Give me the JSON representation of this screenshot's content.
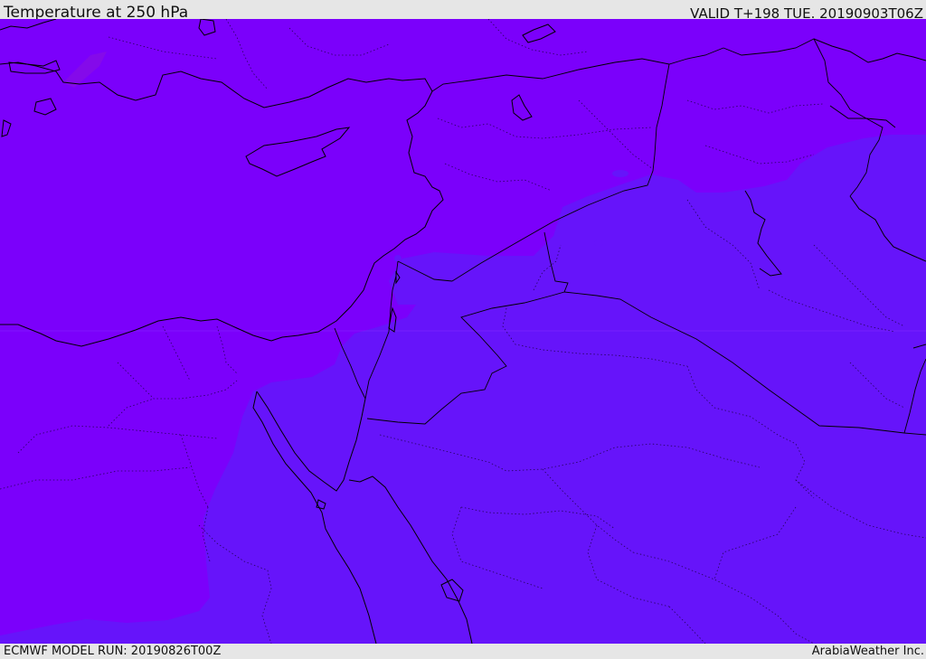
{
  "header": {
    "title": "Temperature at 250 hPa",
    "valid_time": "VALID T+198 TUE. 20190903T06Z"
  },
  "footer": {
    "model_run": "ECMWF MODEL RUN: 20190826T00Z",
    "credit": "ArabiaWeather Inc."
  },
  "map": {
    "field": "temperature-250hPa",
    "colors": {
      "warmer_field": "#7b00fb",
      "cooler_field": "#6614fa",
      "hotspot": "#8a10e0",
      "borders": "#000000"
    }
  }
}
